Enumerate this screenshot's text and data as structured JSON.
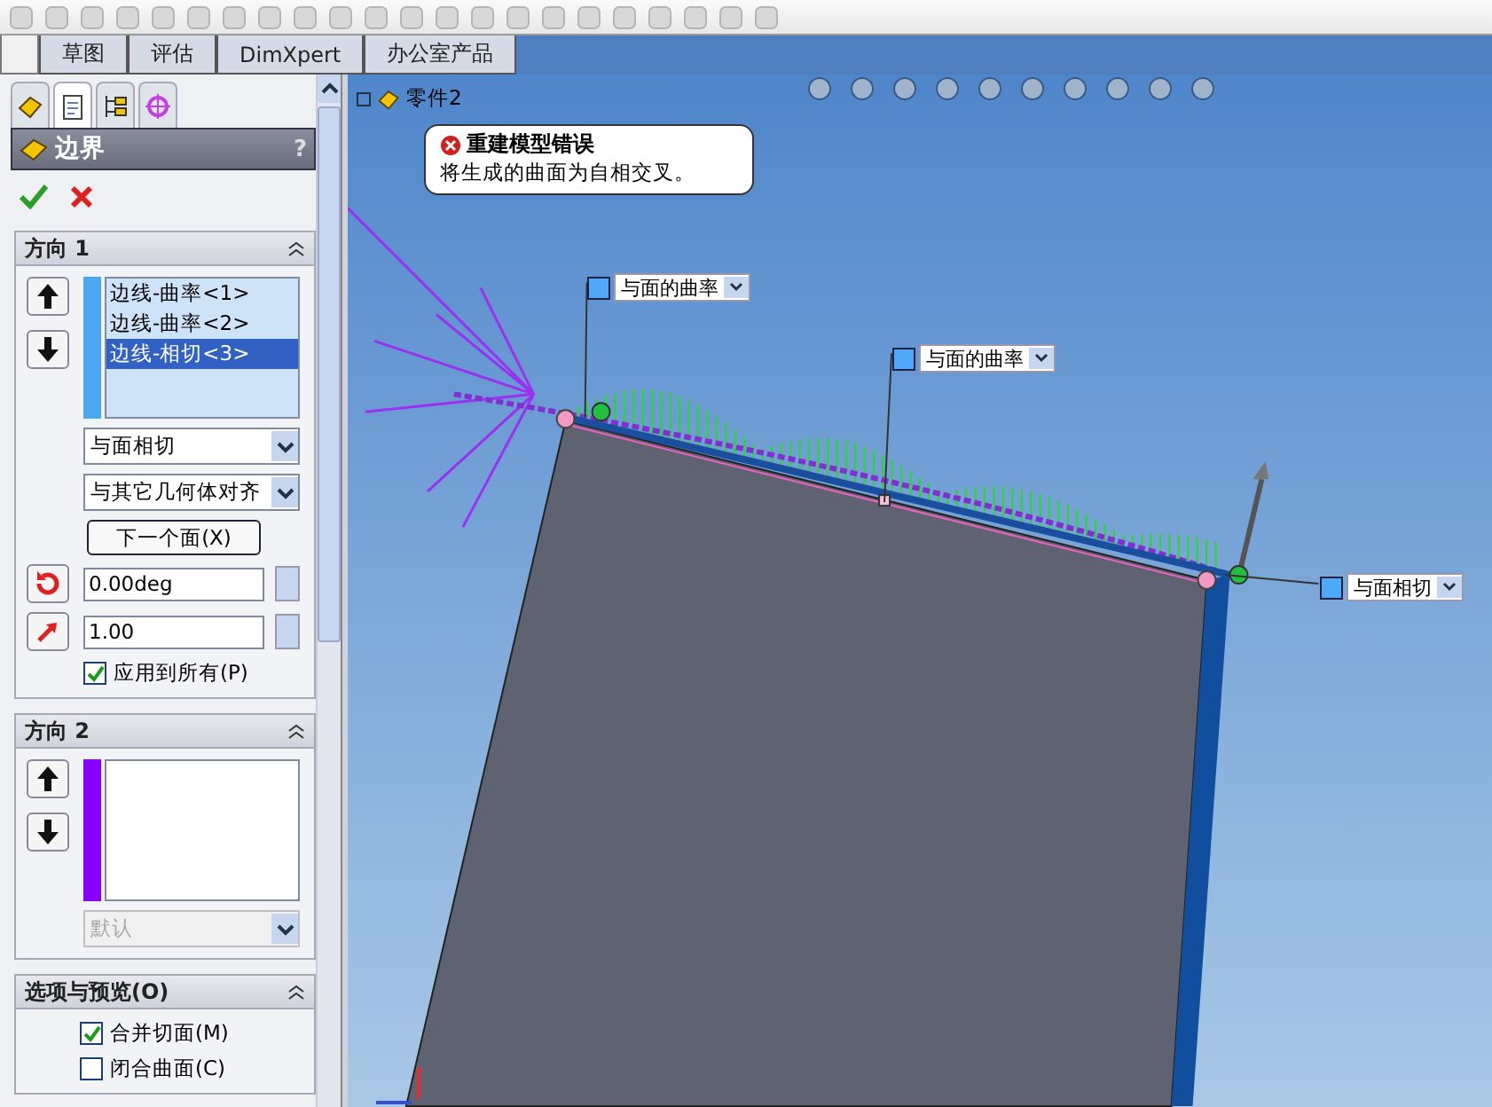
{
  "command_tabs": [
    {
      "label": "草图",
      "selected": false
    },
    {
      "label": "评估",
      "selected": false
    },
    {
      "label": "DimXpert",
      "selected": false
    },
    {
      "label": "办公室产品",
      "selected": false
    }
  ],
  "panel_tabs": [
    {
      "selected": false
    },
    {
      "selected": true
    },
    {
      "selected": false
    },
    {
      "selected": false
    }
  ],
  "feature": {
    "title": "边界",
    "help": "?"
  },
  "direction1": {
    "title": "方向 1",
    "color": "#4da6f0",
    "items": [
      {
        "label": "边线-曲率<1>",
        "selected": false
      },
      {
        "label": "边线-曲率<2>",
        "selected": false
      },
      {
        "label": "边线-相切<3>",
        "selected": true
      }
    ],
    "tangent_type": "与面相切",
    "disabled": false,
    "alignment": "与其它几何体对齐",
    "next_face_button": "下一个面(X)",
    "angle": "0.00deg",
    "magnitude": "1.00",
    "apply_all": {
      "label": "应用到所有(P)",
      "checked": true
    }
  },
  "direction2": {
    "title": "方向 2",
    "color": "#8800ff",
    "tangent_type": "默认",
    "disabled": true
  },
  "options": {
    "title": "选项与预览(O)",
    "checkboxes": [
      {
        "label": "合并切面(M)",
        "checked": true
      },
      {
        "label": "闭合曲面(C)",
        "checked": false
      }
    ]
  },
  "tree": {
    "root": "零件2"
  },
  "error": {
    "title": "重建模型错误",
    "message": "将生成的曲面为自相交叉。"
  },
  "handles": [
    {
      "label": "与面的曲率"
    },
    {
      "label": "与面的曲率"
    },
    {
      "label": "与面相切"
    }
  ]
}
